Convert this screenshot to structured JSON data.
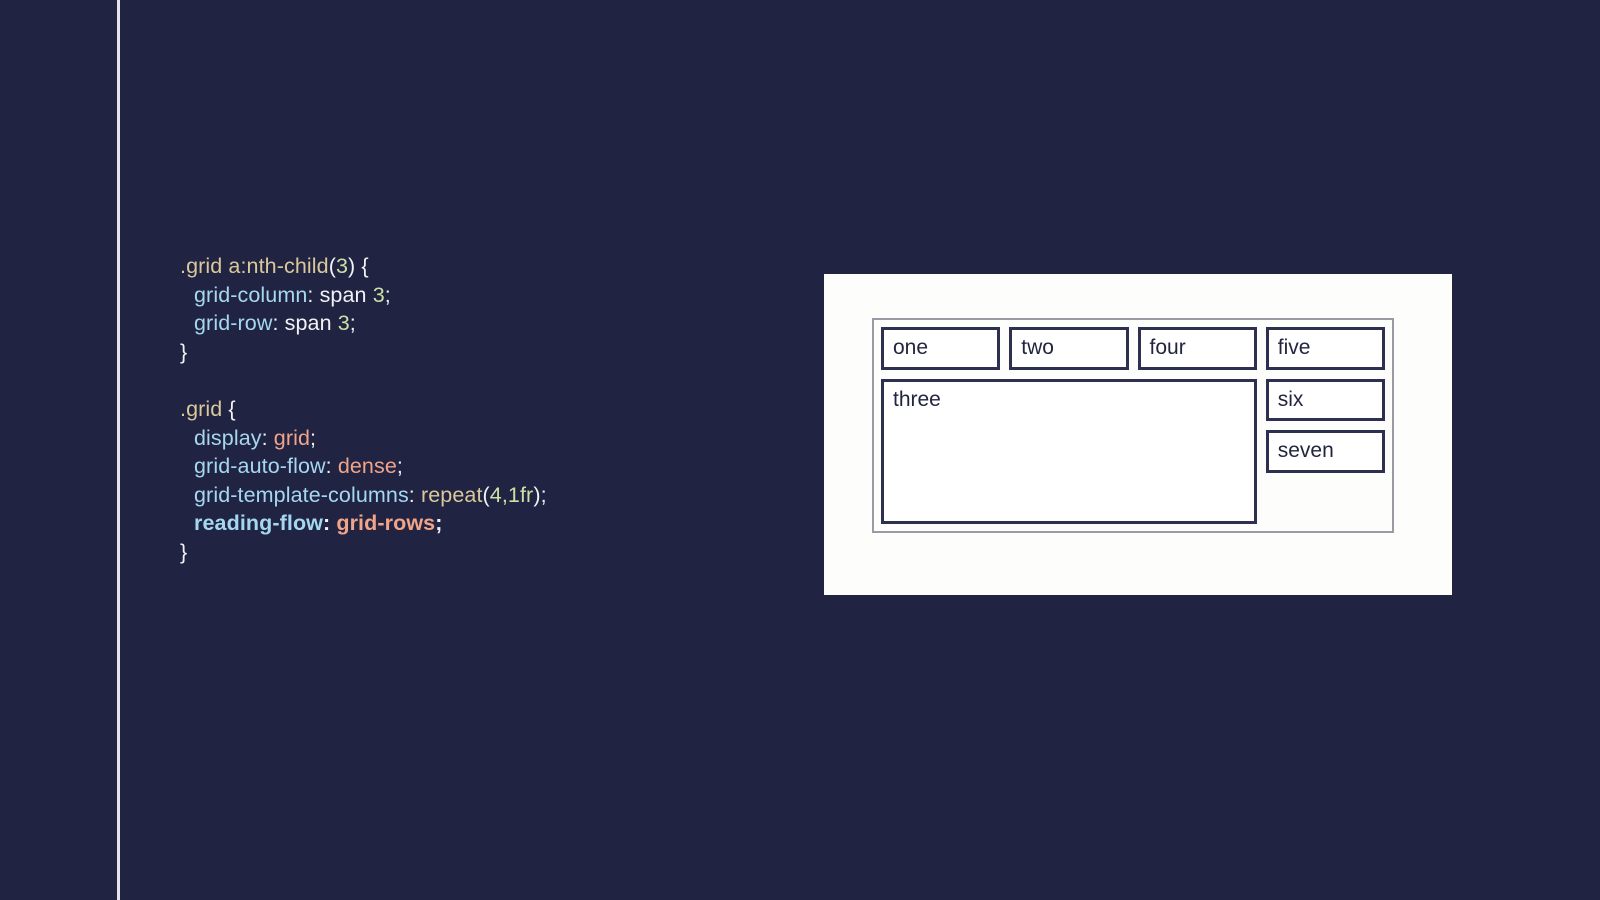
{
  "theme": {
    "background": "#212342",
    "rule_color": "#e8e2e8",
    "panel_background": "#fdfdfb",
    "cell_border": "#2e3050",
    "container_border": "#9a9aa6",
    "selector_color": "#d9c89b",
    "property_color": "#a5d8f0",
    "keyword_color": "#f0a488",
    "number_color": "#cfe0a6",
    "plain_color": "#f2f2f6"
  },
  "code": {
    "rule_one": {
      "selector": {
        "dot_grid": ".grid ",
        "pseudo": "a:nth-child",
        "paren_open": "(",
        "arg": "3",
        "paren_close": ")",
        "brace_open": " {"
      },
      "declarations": [
        {
          "property": "grid-column",
          "colon": ": ",
          "value": "span ",
          "number": "3",
          "semicolon": ";"
        },
        {
          "property": "grid-row",
          "colon": ": ",
          "value": "span ",
          "number": "3",
          "semicolon": ";"
        }
      ],
      "brace_close": "}"
    },
    "rule_two": {
      "selector": {
        "dot_grid": ".grid",
        "brace_open": " {"
      },
      "declarations": [
        {
          "property": "display",
          "colon": ": ",
          "keyword": "grid",
          "semicolon": ";",
          "bold": false
        },
        {
          "property": "grid-auto-flow",
          "colon": ": ",
          "keyword": "dense",
          "semicolon": ";",
          "bold": false
        },
        {
          "property": "grid-template-columns",
          "colon": ": ",
          "fn_name": "repeat",
          "fn_open": "(",
          "fn_args": "4,1fr",
          "fn_close": ")",
          "semicolon": ";",
          "bold": false
        },
        {
          "property": "reading-flow",
          "colon": ": ",
          "keyword": "grid-rows",
          "semicolon": ";",
          "bold": true
        }
      ],
      "brace_close": "}"
    }
  },
  "demo": {
    "cells": [
      {
        "label": "one",
        "span": false
      },
      {
        "label": "two",
        "span": false
      },
      {
        "label": "four",
        "span": false
      },
      {
        "label": "five",
        "span": false
      },
      {
        "label": "three",
        "span": true
      },
      {
        "label": "six",
        "span": false
      },
      {
        "label": "seven",
        "span": false
      }
    ]
  }
}
